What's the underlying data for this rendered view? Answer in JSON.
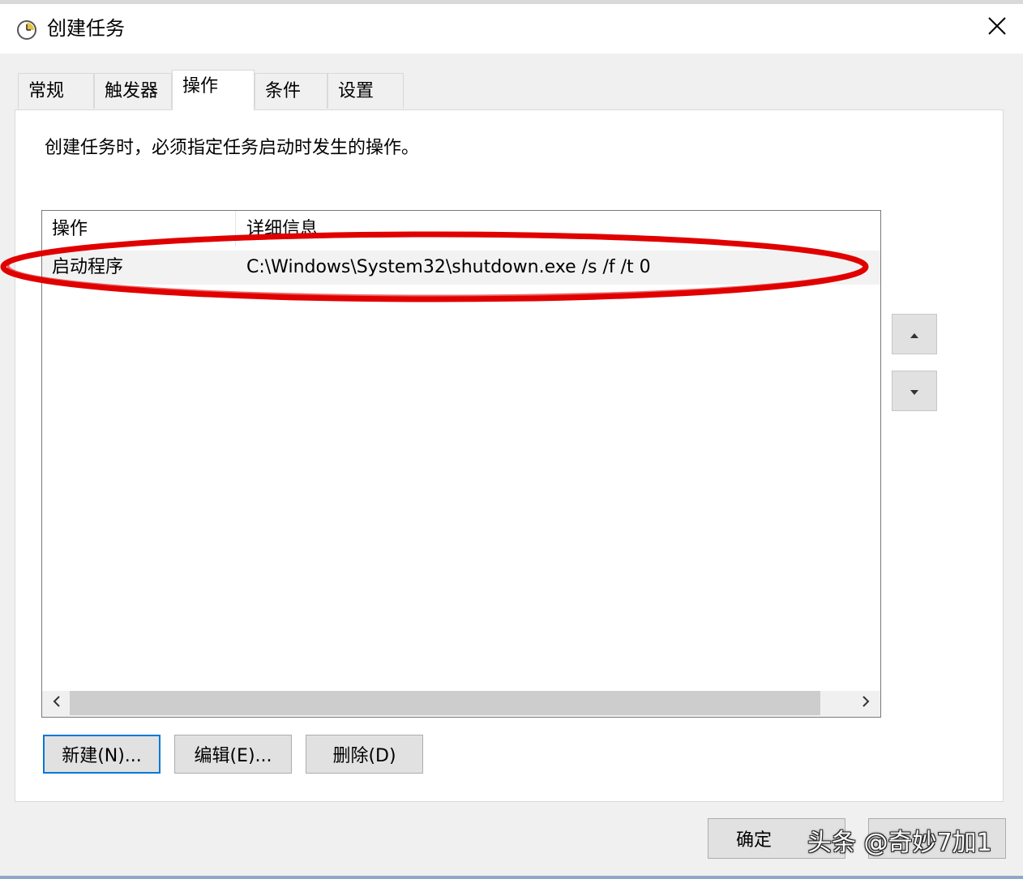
{
  "window": {
    "title": "创建任务",
    "close_icon": "close-icon"
  },
  "tabs": [
    {
      "label": "常规",
      "active": false
    },
    {
      "label": "触发器",
      "active": false
    },
    {
      "label": "操作",
      "active": true
    },
    {
      "label": "条件",
      "active": false
    },
    {
      "label": "设置",
      "active": false
    }
  ],
  "panel": {
    "description": "创建任务时，必须指定任务启动时发生的操作。"
  },
  "actions_list": {
    "columns": [
      "操作",
      "详细信息"
    ],
    "rows": [
      {
        "action": "启动程序",
        "details": "C:\\Windows\\System32\\shutdown.exe /s /f /t 0"
      }
    ]
  },
  "buttons": {
    "new": "新建(N)...",
    "edit": "编辑(E)...",
    "delete": "删除(D)",
    "ok": "确定"
  },
  "watermark": "头条 @奇妙7加1",
  "colors": {
    "accent": "#0078d7",
    "highlight_ellipse": "#e00000"
  }
}
